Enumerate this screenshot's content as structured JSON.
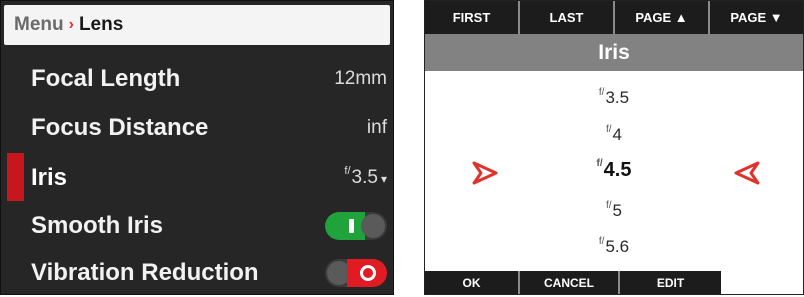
{
  "menu_panel": {
    "breadcrumb": {
      "parent": "Menu",
      "separator": "›",
      "current": "Lens"
    },
    "rows": [
      {
        "label": "Focal Length",
        "value": "12mm"
      },
      {
        "label": "Focus Distance",
        "value": "inf"
      },
      {
        "label": "Iris",
        "value_prefix": "f/",
        "value": "3.5",
        "caret": "▾",
        "selected": true
      },
      {
        "label": "Smooth Iris",
        "toggle": "on"
      },
      {
        "label": "Vibration Reduction",
        "toggle": "off"
      }
    ]
  },
  "picker_panel": {
    "top_buttons": [
      "FIRST",
      "LAST",
      "PAGE ▲",
      "PAGE ▼"
    ],
    "title": "Iris",
    "fstop_prefix": "f/",
    "options": [
      "3.5",
      "4",
      "4.5",
      "5",
      "5.6"
    ],
    "selected_index": 2,
    "bottom_buttons": [
      "OK",
      "CANCEL",
      "EDIT"
    ]
  },
  "colors": {
    "accent_red": "#e0322a",
    "toggle_on": "#1fa33a",
    "toggle_off": "#e01b23",
    "menu_bg": "#262626",
    "title_bar": "#828282"
  }
}
